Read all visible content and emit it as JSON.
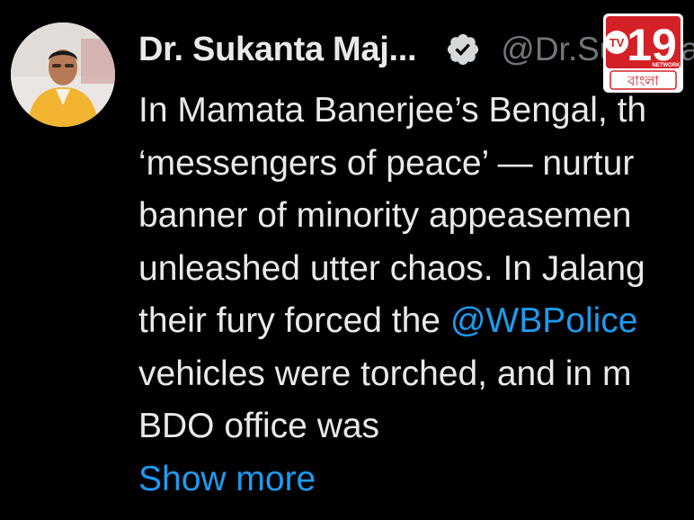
{
  "author": {
    "name": "Dr. Sukanta Maj...",
    "handle": "@Dr.Sukanta"
  },
  "verified_icon": "verified-badge-icon",
  "tweet": {
    "lines": [
      "In Mamata Banerjee’s Bengal, th",
      "‘messengers of peace’ — nurtur",
      "banner of minority appeasemen",
      "unleashed utter chaos. In Jalang",
      "their fury forced the ",
      "vehicles were torched, and in m",
      "BDO office was"
    ],
    "mention": "@WBPolice",
    "show_more": "Show more"
  },
  "watermark": {
    "tv": "TV",
    "number": "19",
    "network": "NETWORK",
    "bangla": "বাংলা"
  },
  "colors": {
    "background": "#000000",
    "text": "#e7e9ea",
    "link": "#1d9bf0",
    "muted": "#71767b",
    "logo_red": "#d42027"
  }
}
